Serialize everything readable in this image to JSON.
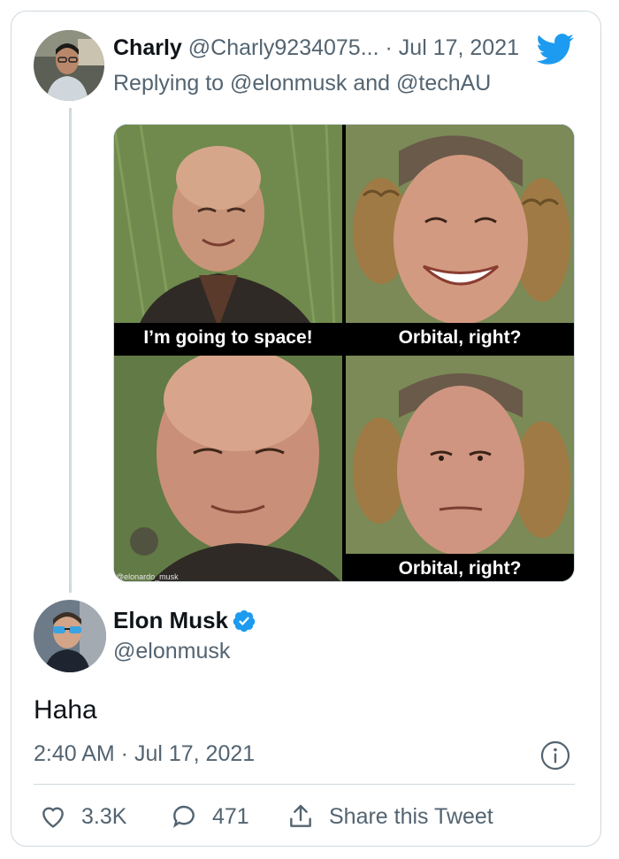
{
  "reply_tweet": {
    "display_name": "Charly",
    "handle": "@Charly9234075...",
    "separator": "·",
    "date": "Jul 17, 2021",
    "replying_to": "Replying to @elonmusk and @techAU"
  },
  "meme": {
    "captions": [
      "I’m going to space!",
      "Orbital, right?",
      "Orbital, right?"
    ],
    "watermark": "@elonardo_musk"
  },
  "main_tweet": {
    "display_name": "Elon Musk",
    "handle": "@elonmusk",
    "text": "Haha",
    "timestamp": "2:40 AM · Jul 17, 2021",
    "likes": "3.3K",
    "replies": "471",
    "share_label": "Share this Tweet"
  },
  "colors": {
    "twitter_blue": "#1d9bf0",
    "muted_text": "#536471",
    "border": "#cfd9de"
  },
  "icons": [
    "twitter-bird-icon",
    "verified-badge-icon",
    "info-icon",
    "heart-icon",
    "reply-bubble-icon",
    "share-icon"
  ]
}
